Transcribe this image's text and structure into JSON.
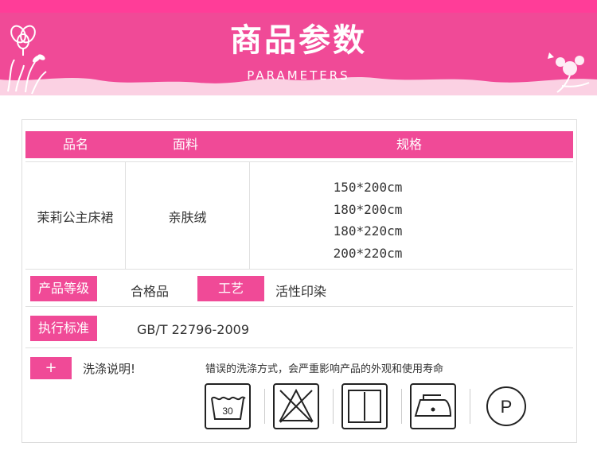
{
  "banner": {
    "title": "商品参数",
    "subtitle": "PARAMETERS",
    "colors": {
      "pink": "#f04a97",
      "light_pink": "#fbd1e3"
    }
  },
  "table": {
    "headers": [
      "品名",
      "面料",
      "规格"
    ],
    "product_name": "茉莉公主床裙",
    "fabric": "亲肤绒",
    "sizes": [
      "150*200cm",
      "180*200cm",
      "180*220cm",
      "200*220cm"
    ]
  },
  "attributes": {
    "grade_label": "产品等级",
    "grade_value": "合格品",
    "craft_label": "工艺",
    "craft_value": "活性印染",
    "standard_label": "执行标准",
    "standard_value": "GB/T 22796-2009"
  },
  "care": {
    "tag": "+",
    "label": "洗涤说明!",
    "note": "错误的洗涤方式，会严重影响产品的外观和使用寿命",
    "icons": [
      "wash-30-icon",
      "no-bleach-icon",
      "line-dry-icon",
      "iron-low-icon",
      "dry-clean-p-icon"
    ],
    "wash_temp": "30",
    "dry_clean_letter": "P"
  }
}
